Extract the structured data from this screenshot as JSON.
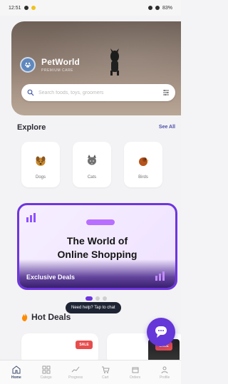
{
  "status_bar": {
    "time": "12:51",
    "indicators": [
      "signal",
      "wifi",
      "battery"
    ],
    "battery": "83%"
  },
  "header": {
    "brand_name": "PetWorld",
    "brand_subtitle": "PREMIUM CARE",
    "search_placeholder": "Search foods, toys, groomers",
    "filter_icon": "filter-icon",
    "avatar_icon": "paw-icon"
  },
  "explore": {
    "title": "Explore",
    "see_all": "See All",
    "categories": [
      {
        "label": "Dogs",
        "icon": "dog-icon"
      },
      {
        "label": "Cats",
        "icon": "cat-icon"
      },
      {
        "label": "Birds",
        "icon": "bird-icon"
      }
    ]
  },
  "banner": {
    "title_line_1": "The World of",
    "title_line_2": "Online Shopping",
    "caption": "Exclusive Deals",
    "accent": "#6e35e0"
  },
  "pager": {
    "active_index": 0,
    "count": 3
  },
  "help": {
    "text": "Need help? Tap to chat"
  },
  "hot_deals": {
    "title": "Hot Deals",
    "icon": "fire-icon",
    "items": [
      {
        "badge": "SALE"
      },
      {
        "badge": "SALE"
      }
    ]
  },
  "chat_fab": {
    "icon": "chat-icon"
  },
  "bottom_nav": {
    "items": [
      {
        "label": "Home",
        "icon": "home-icon",
        "active": true
      },
      {
        "label": "Catego",
        "icon": "grid-icon",
        "active": false
      },
      {
        "label": "Progress",
        "icon": "chart-icon",
        "active": false
      },
      {
        "label": "Cart",
        "icon": "cart-icon",
        "active": false
      },
      {
        "label": "Orders",
        "icon": "box-icon",
        "active": false
      },
      {
        "label": "Profile",
        "icon": "profile-icon",
        "active": false
      }
    ]
  },
  "colors": {
    "background": "#f3f3f5",
    "primary": "#6e35e0",
    "text_dark": "#2b2b33",
    "accent_red": "#e74d4d"
  }
}
